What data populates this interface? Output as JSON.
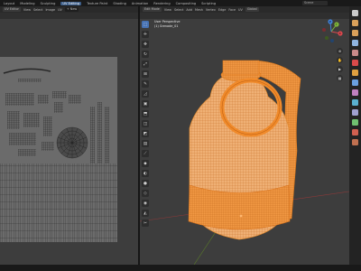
{
  "top_bar": {
    "workspaces": [
      {
        "label": "Layout",
        "active": false
      },
      {
        "label": "Modeling",
        "active": false
      },
      {
        "label": "Sculpting",
        "active": false
      },
      {
        "label": "UV Editing",
        "active": true
      },
      {
        "label": "Texture Paint",
        "active": false
      },
      {
        "label": "Shading",
        "active": false
      },
      {
        "label": "Animation",
        "active": false
      },
      {
        "label": "Rendering",
        "active": false
      },
      {
        "label": "Compositing",
        "active": false
      },
      {
        "label": "Scripting",
        "active": false
      }
    ],
    "scene": "Scene"
  },
  "uv_editor": {
    "header": {
      "mode": "UV Editor",
      "menus": [
        "View",
        "Select",
        "Image",
        "UV"
      ],
      "image": "+ New"
    },
    "grid_color": "#6b6b6b"
  },
  "viewport": {
    "header": {
      "mode": "Edit Mode",
      "menus": [
        "View",
        "Select",
        "Add",
        "Mesh",
        "Vertex",
        "Edge",
        "Face",
        "UV"
      ],
      "transform": "Global"
    },
    "info": {
      "view": "User Perspective",
      "object": "(1) Grenade_01"
    },
    "tools": [
      {
        "icon": "select-box-icon",
        "glyph": "⬚",
        "active": true
      },
      {
        "icon": "cursor-icon",
        "glyph": "✛",
        "active": false
      },
      {
        "icon": "move-icon",
        "glyph": "✥",
        "active": false
      },
      {
        "icon": "rotate-icon",
        "glyph": "↻",
        "active": false
      },
      {
        "icon": "scale-icon",
        "glyph": "⤢",
        "active": false
      },
      {
        "icon": "transform-icon",
        "glyph": "⊞",
        "active": false
      },
      {
        "icon": "annotate-icon",
        "glyph": "✎",
        "active": false
      },
      {
        "icon": "measure-icon",
        "glyph": "◿",
        "active": false
      },
      {
        "icon": "add-cube-icon",
        "glyph": "▣",
        "active": false
      },
      {
        "icon": "extrude-icon",
        "glyph": "⬒",
        "active": false
      },
      {
        "icon": "inset-icon",
        "glyph": "◫",
        "active": false
      },
      {
        "icon": "bevel-icon",
        "glyph": "◩",
        "active": false
      },
      {
        "icon": "loop-cut-icon",
        "glyph": "▤",
        "active": false
      },
      {
        "icon": "knife-icon",
        "glyph": "⟋",
        "active": false
      },
      {
        "icon": "poly-build-icon",
        "glyph": "◆",
        "active": false
      },
      {
        "icon": "spin-icon",
        "glyph": "◐",
        "active": false
      },
      {
        "icon": "smooth-icon",
        "glyph": "●",
        "active": false
      },
      {
        "icon": "edge-slide-icon",
        "glyph": "◇",
        "active": false
      },
      {
        "icon": "shrink-icon",
        "glyph": "◉",
        "active": false
      },
      {
        "icon": "shear-icon",
        "glyph": "◭",
        "active": false
      },
      {
        "icon": "rip-icon",
        "glyph": "✂",
        "active": false
      }
    ],
    "gizmo": {
      "x": "X",
      "y": "Y",
      "z": "Z"
    },
    "mesh_color": "#f0a050",
    "wire_color": "#ff8c1a"
  },
  "sidebar": {
    "icons": [
      "tool-icon",
      "render-icon",
      "output-icon",
      "view-layer-icon",
      "scene-icon",
      "world-icon",
      "object-icon",
      "modifier-icon",
      "particles-icon",
      "physics-icon",
      "constraints-icon",
      "data-icon",
      "material-icon",
      "texture-icon"
    ]
  }
}
